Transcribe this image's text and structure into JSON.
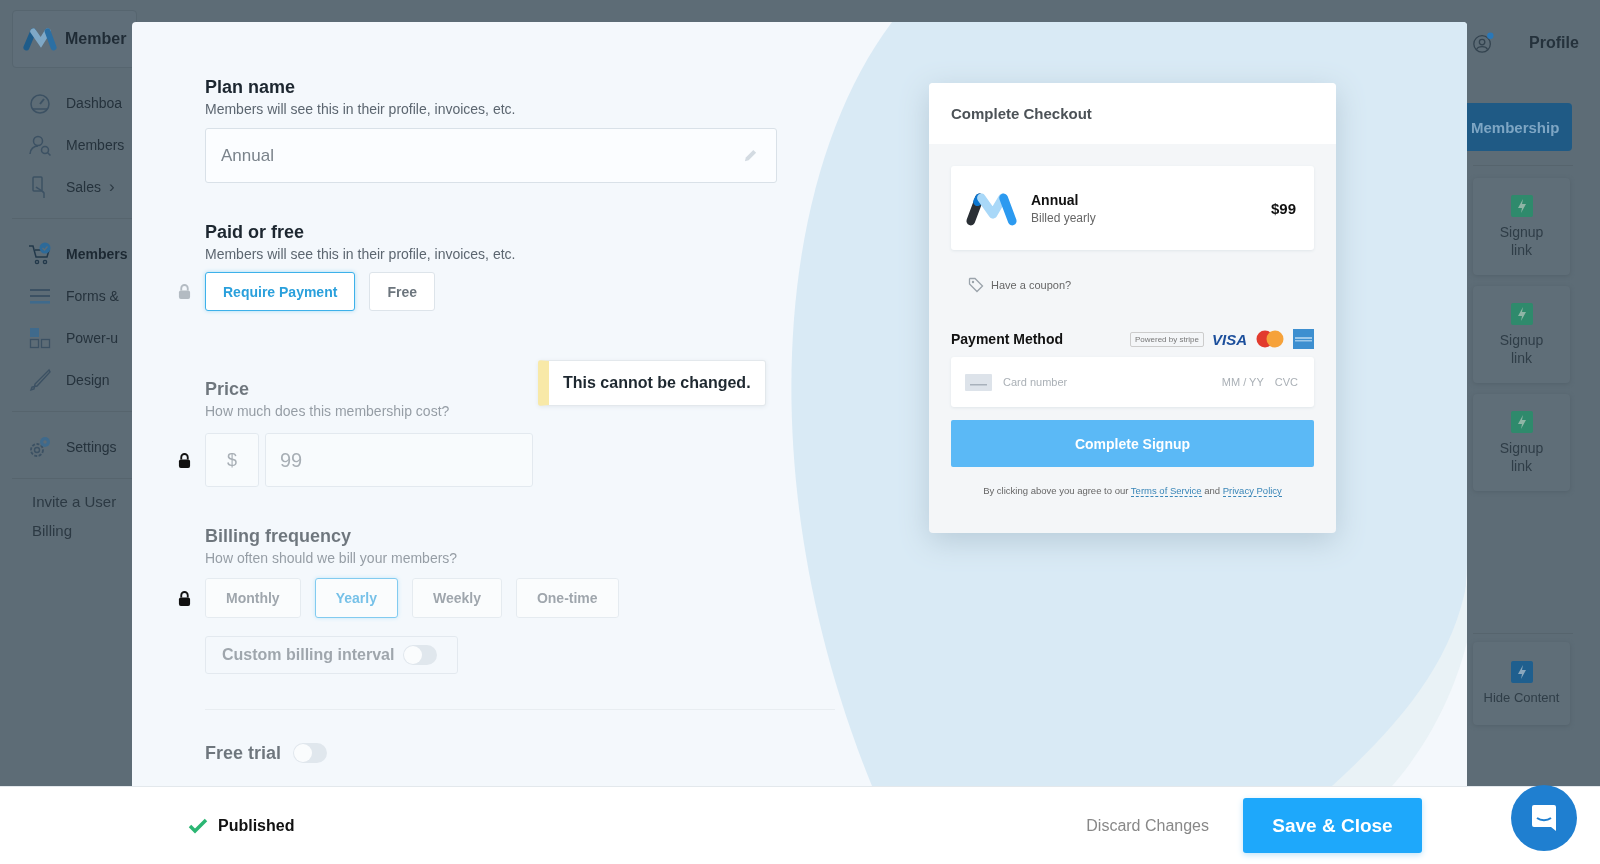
{
  "app": {
    "brand": "Member",
    "nav_groups": [
      {
        "items": [
          {
            "label": "Dashboa",
            "selected": false
          },
          {
            "label": "Members",
            "selected": false
          },
          {
            "label": "Sales",
            "selected": false,
            "arrow": "›"
          }
        ]
      },
      {
        "items": [
          {
            "label": "Members",
            "selected": true
          },
          {
            "label": "Forms &",
            "selected": false
          },
          {
            "label": "Power-u",
            "selected": false
          },
          {
            "label": "Design",
            "selected": false
          }
        ]
      },
      {
        "items": [
          {
            "label": "Settings",
            "selected": false
          }
        ]
      }
    ],
    "links": [
      "Invite a User",
      "Billing"
    ],
    "profile": "Profile",
    "membership_button": "Membership",
    "content_cards": [
      {
        "label": "Signup link",
        "color": "#2f8a6c"
      },
      {
        "label": "Signup link",
        "color": "#2f8a6c"
      },
      {
        "label": "Signup link",
        "color": "#2f8a6c"
      }
    ],
    "bottom_card": {
      "label": "Hide Content",
      "color": "#1f5f8e"
    }
  },
  "modal": {
    "plan_name": {
      "label": "Plan name",
      "hint": "Members will see this in their profile, invoices, etc.",
      "value": "Annual"
    },
    "paid_or_free": {
      "label": "Paid or free",
      "hint": "Members will see this in their profile, invoices, etc.",
      "disabled": false,
      "options": [
        {
          "label": "Require Payment",
          "selected": true
        },
        {
          "label": "Free",
          "selected": false
        }
      ]
    },
    "tooltip": "This cannot be changed.",
    "price": {
      "label": "Price",
      "hint": "How much does this membership cost?",
      "disabled": true,
      "currency": "$",
      "value": "99"
    },
    "billing_frequency": {
      "label": "Billing frequency",
      "hint": "How often should we bill your members?",
      "disabled": true,
      "options": [
        {
          "label": "Monthly",
          "selected": false
        },
        {
          "label": "Yearly",
          "selected": true
        },
        {
          "label": "Weekly",
          "selected": false
        },
        {
          "label": "One-time",
          "selected": false
        }
      ],
      "custom_interval": {
        "label": "Custom billing interval",
        "on": false
      }
    },
    "free_trial": {
      "label": "Free trial",
      "on": false
    },
    "checkout": {
      "title": "Complete Checkout",
      "plan": {
        "name": "Annual",
        "period": "Billed yearly",
        "price": "$99"
      },
      "coupon": "Have a coupon?",
      "payment_label": "Payment Method",
      "powered_by": "Powered by stripe",
      "visa": "VISA",
      "card_placeholder": "Card number",
      "expiry_placeholder": "MM / YY",
      "cvc_placeholder": "CVC",
      "button": "Complete Signup",
      "terms": {
        "before": "By clicking above you agree to our",
        "terms_link": "Terms of Service",
        "middle": "and",
        "privacy_link": "Privacy Policy"
      }
    }
  },
  "footer": {
    "status": "Published",
    "published": true,
    "discard": "Discard Changes",
    "save": "Save & Close"
  }
}
